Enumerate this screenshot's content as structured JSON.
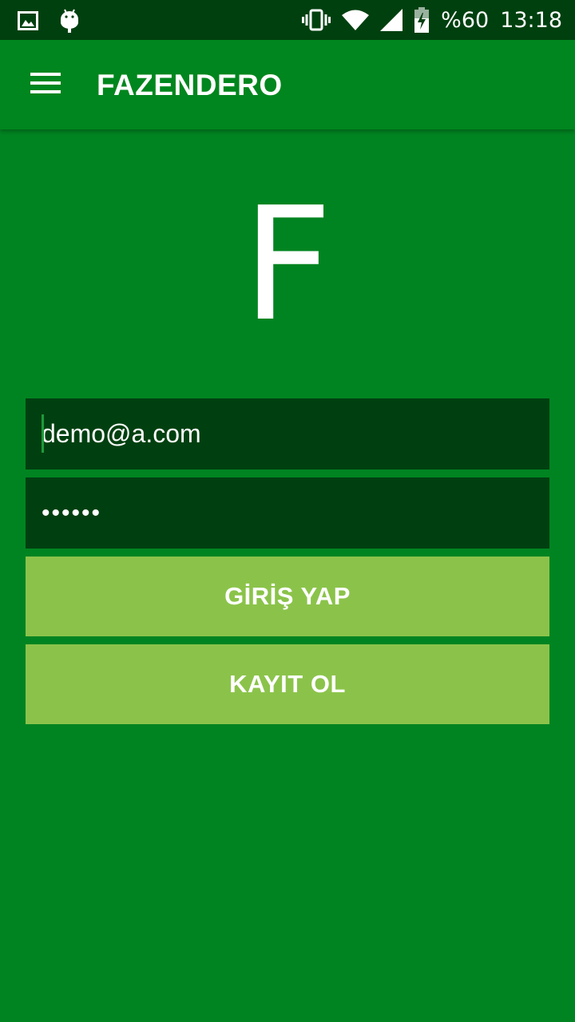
{
  "status_bar": {
    "battery": "%60",
    "time": "13:18",
    "icons": [
      "image-icon",
      "android-icon",
      "vibrate-icon",
      "wifi-icon",
      "signal-icon",
      "battery-charging-icon"
    ]
  },
  "app_bar": {
    "title": "FAZENDERO",
    "menu_icon": "hamburger-menu-icon"
  },
  "logo": {
    "letter": "F"
  },
  "form": {
    "email_value": "demo@a.com",
    "password_value": "••••••",
    "login_label": "GİRİŞ YAP",
    "register_label": "KAYIT OL"
  },
  "colors": {
    "background": "#008421",
    "status_bar": "#00400f",
    "input_background": "#004010",
    "button": "#8bc34a",
    "text": "#ffffff"
  }
}
